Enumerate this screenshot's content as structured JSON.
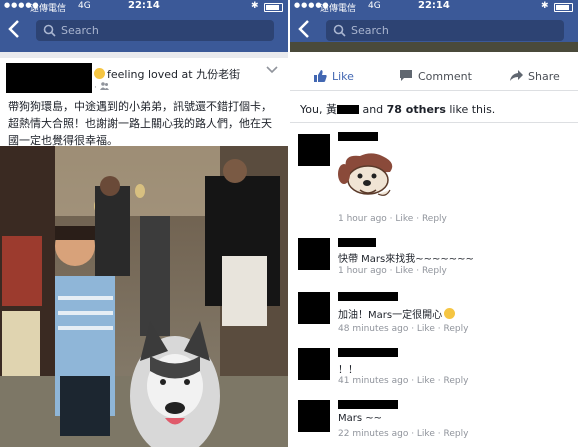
{
  "status": {
    "carrier": "遠傳電信",
    "network": "4G",
    "time": "22:14"
  },
  "search": {
    "placeholder": "Search"
  },
  "post": {
    "feeling": "feeling loved at 九份老街",
    "meta": "· ",
    "text": "帶狗狗環島，中途遇到的小弟弟，訊號還不錯打個卡，超熱情大合照！也謝謝一路上關心我的路人們，他在天國一定也覺得很幸福。"
  },
  "actions": {
    "like": "Like",
    "comment": "Comment",
    "share": "Share"
  },
  "likes": {
    "prefix": "You, 黃",
    "and": " and ",
    "count": "78 others",
    "suffix": " like this."
  },
  "comments": [
    {
      "text": "",
      "meta": "1 hour ago · ",
      "like": "Like",
      "dot": " · ",
      "reply": "Reply"
    },
    {
      "text": "快帶 Mars來找我~~~~~~~",
      "meta": "1 hour ago · ",
      "like": "Like",
      "dot": " · ",
      "reply": "Reply"
    },
    {
      "text": "加油！Mars一定很開心",
      "meta": "48 minutes ago · ",
      "like": "Like",
      "dot": " · ",
      "reply": "Reply"
    },
    {
      "text": "！！",
      "meta": "41 minutes ago · ",
      "like": "Like",
      "dot": " · ",
      "reply": "Reply"
    },
    {
      "text": "Mars ~~",
      "meta": "22 minutes ago · ",
      "like": "Like",
      "dot": " · ",
      "reply": "Reply"
    }
  ],
  "colors": {
    "brand": "#3b5998",
    "search_bg": "#2d4373",
    "like_blue": "#4267b2"
  }
}
